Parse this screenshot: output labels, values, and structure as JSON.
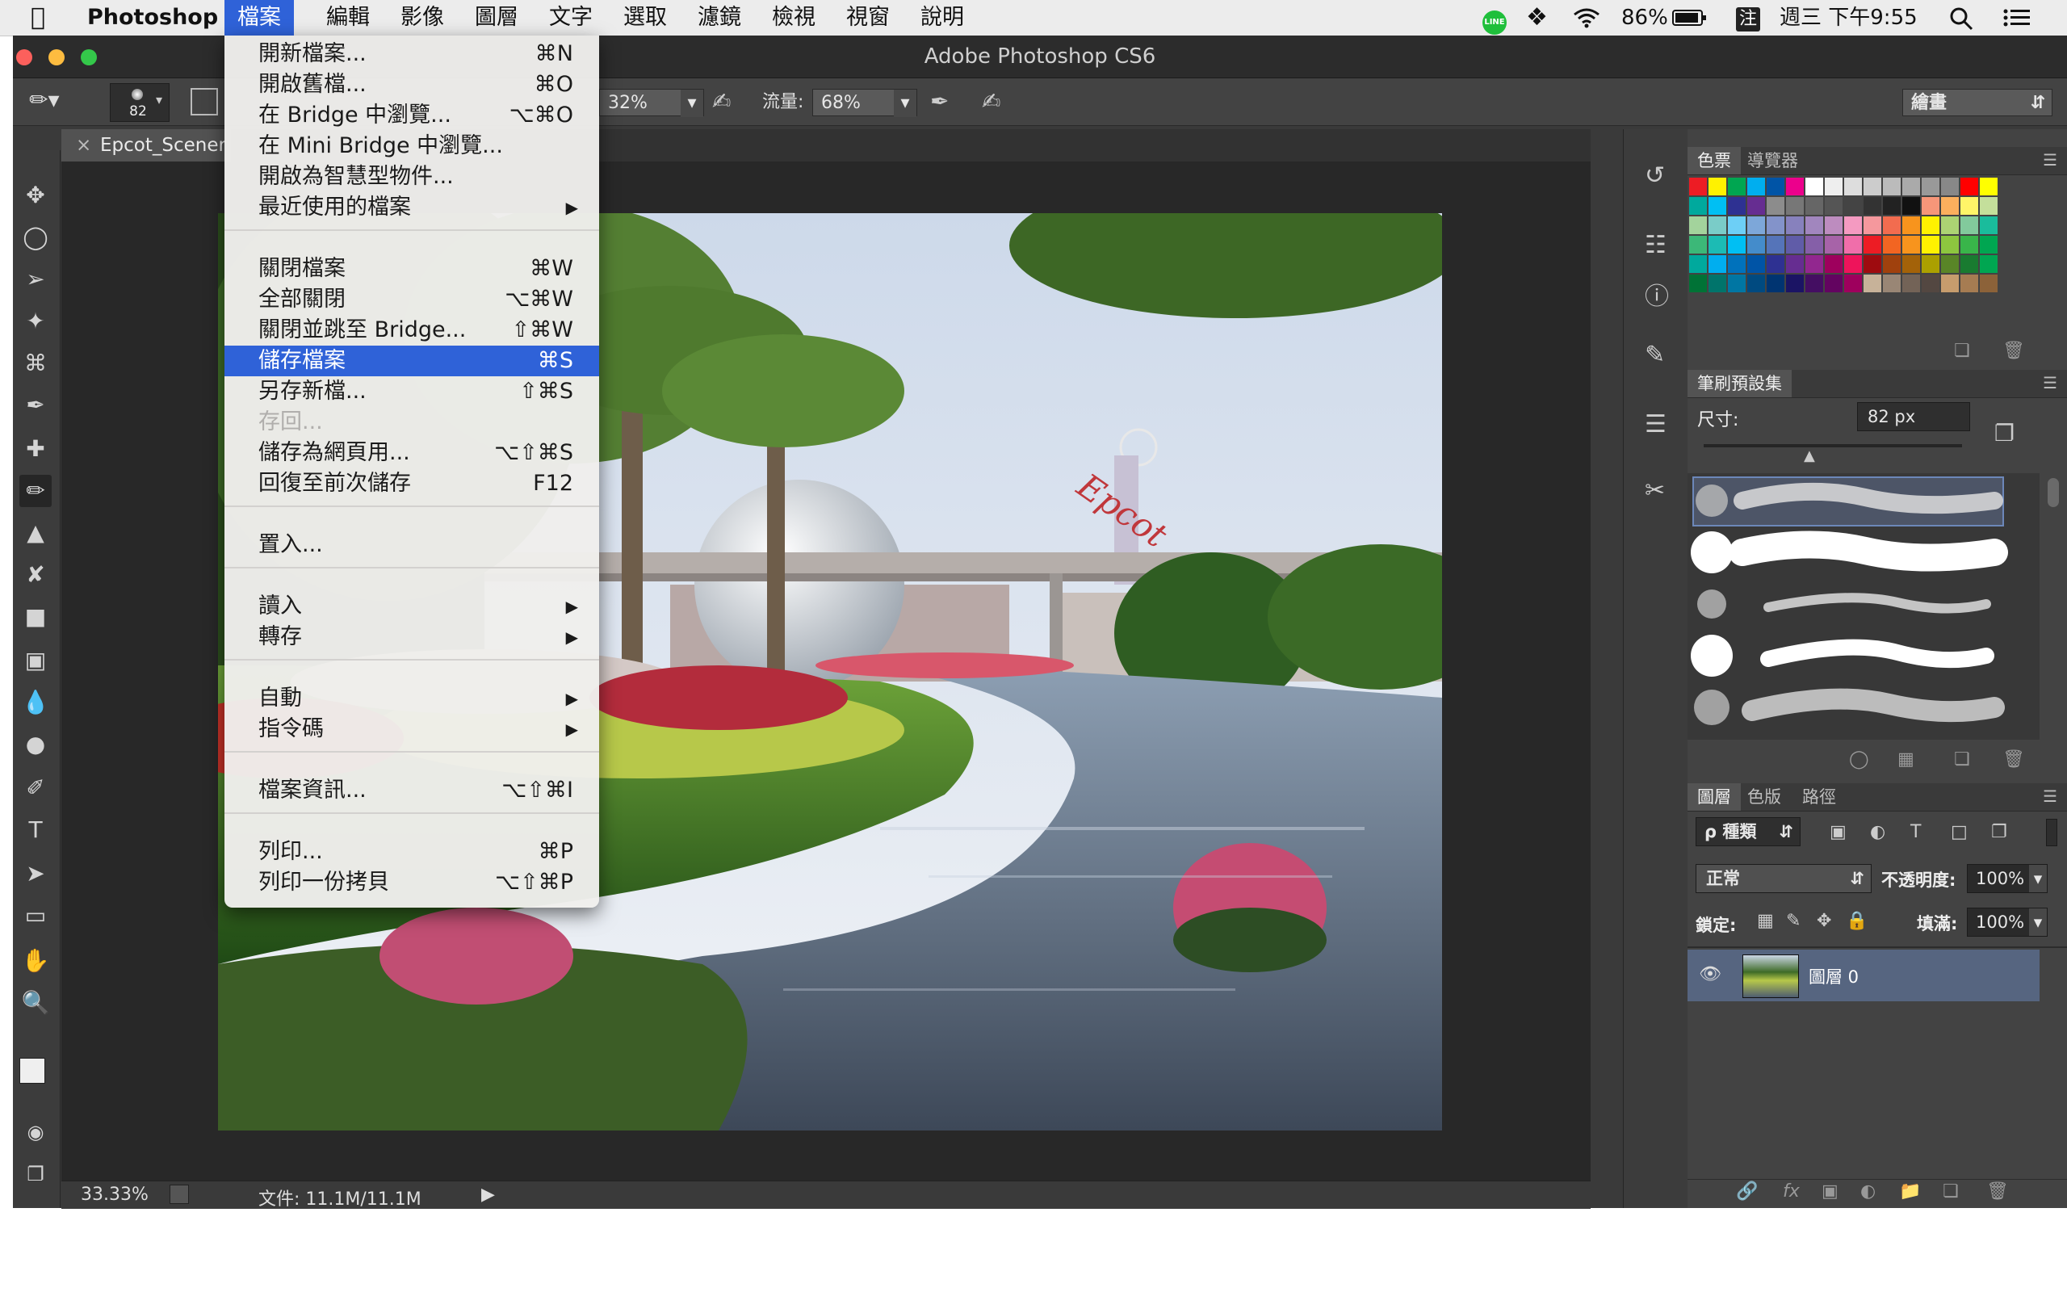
{
  "menubar": {
    "apple_icon": "apple-logo",
    "app_name": "Photoshop",
    "items": [
      "檔案",
      "編輯",
      "影像",
      "圖層",
      "文字",
      "選取",
      "濾鏡",
      "檢視",
      "視窗",
      "說明"
    ],
    "battery": "86%",
    "clock": "週三 下午9:55",
    "input_method": "注"
  },
  "window": {
    "title": "Adobe Photoshop CS6"
  },
  "options_bar": {
    "brush_size": "82",
    "opacity": "32%",
    "flow_label": "流量:",
    "flow": "68%",
    "workspace": "繪畫"
  },
  "document": {
    "tab_title": "Epcot_Scener",
    "close_glyph": "×",
    "zoom": "33.33%",
    "doc_info": "文件: 11.1M/11.1M",
    "photo_sign_text": "Epcot"
  },
  "file_menu": {
    "items": [
      {
        "label": "開新檔案...",
        "shortcut": "⌘N"
      },
      {
        "label": "開啟舊檔...",
        "shortcut": "⌘O"
      },
      {
        "label": "在 Bridge 中瀏覽...",
        "shortcut": "⌥⌘O"
      },
      {
        "label": "在 Mini Bridge 中瀏覽...",
        "shortcut": ""
      },
      {
        "label": "開啟為智慧型物件...",
        "shortcut": ""
      },
      {
        "label": "最近使用的檔案",
        "shortcut": "",
        "submenu": true
      },
      {
        "label": "關閉檔案",
        "shortcut": "⌘W"
      },
      {
        "label": "全部關閉",
        "shortcut": "⌥⌘W"
      },
      {
        "label": "關閉並跳至 Bridge...",
        "shortcut": "⇧⌘W"
      },
      {
        "label": "儲存檔案",
        "shortcut": "⌘S",
        "selected": true
      },
      {
        "label": "另存新檔...",
        "shortcut": "⇧⌘S"
      },
      {
        "label": "存回...",
        "shortcut": "",
        "disabled": true
      },
      {
        "label": "儲存為網頁用...",
        "shortcut": "⌥⇧⌘S"
      },
      {
        "label": "回復至前次儲存",
        "shortcut": "F12"
      },
      {
        "label": "置入...",
        "shortcut": ""
      },
      {
        "label": "讀入",
        "shortcut": "",
        "submenu": true
      },
      {
        "label": "轉存",
        "shortcut": "",
        "submenu": true
      },
      {
        "label": "自動",
        "shortcut": "",
        "submenu": true
      },
      {
        "label": "指令碼",
        "shortcut": "",
        "submenu": true
      },
      {
        "label": "檔案資訊...",
        "shortcut": "⌥⇧⌘I"
      },
      {
        "label": "列印...",
        "shortcut": "⌘P"
      },
      {
        "label": "列印一份拷貝",
        "shortcut": "⌥⇧⌘P"
      }
    ]
  },
  "swatches_panel": {
    "tabs": [
      "色票",
      "導覽器"
    ],
    "colors": [
      "#ed1c24",
      "#fff200",
      "#00a651",
      "#00aeef",
      "#0054a6",
      "#ec008c",
      "#ffffff",
      "#eeeeee",
      "#dddddd",
      "#cccccc",
      "#bbbbbb",
      "#aaaaaa",
      "#999999",
      "#888888",
      "#ff0000",
      "#ffff00",
      "#00a99d",
      "#00bff3",
      "#2e3192",
      "#662d91",
      "#8c8c8c",
      "#777777",
      "#666666",
      "#555555",
      "#444444",
      "#333333",
      "#222222",
      "#111111",
      "#f69679",
      "#fbaf5d",
      "#fff568",
      "#c4df9b",
      "#a3d39c",
      "#7accc8",
      "#6dcff6",
      "#7da7d9",
      "#8393ca",
      "#8781bd",
      "#a186be",
      "#bd8cbf",
      "#f49ac1",
      "#f5989d",
      "#f26c4f",
      "#f7941d",
      "#fff200",
      "#acd373",
      "#82ca9c",
      "#1abc9c",
      "#3cb878",
      "#1cbbb4",
      "#00bff3",
      "#448ccb",
      "#5574b9",
      "#605ca8",
      "#855fa8",
      "#a763a8",
      "#f06eaa",
      "#ed1c24",
      "#f26522",
      "#f7941d",
      "#fff200",
      "#8dc63f",
      "#39b54a",
      "#00a651",
      "#00a99d",
      "#00aeef",
      "#0072bc",
      "#0054a6",
      "#2e3192",
      "#662d91",
      "#92278f",
      "#9e005d",
      "#ee145b",
      "#9e0b0f",
      "#a0410d",
      "#a36209",
      "#aba000",
      "#598527",
      "#197b30",
      "#00a651",
      "#007236",
      "#00746b",
      "#0076a3",
      "#004a80",
      "#003471",
      "#1b1464",
      "#440e62",
      "#630460",
      "#9e005d",
      "#c7b299",
      "#998675",
      "#736357",
      "#534741",
      "#c69c6d",
      "#a67c52",
      "#8c6239"
    ]
  },
  "brush_presets_panel": {
    "tab": "筆刷預設集",
    "size_label": "尺寸:",
    "size_value": "82 px"
  },
  "layers_panel": {
    "tabs": [
      "圖層",
      "色版",
      "路徑"
    ],
    "filter_label": "ρ 種類",
    "blend_mode": "正常",
    "opacity_label": "不透明度:",
    "opacity_value": "100%",
    "lock_label": "鎖定:",
    "fill_label": "填滿:",
    "fill_value": "100%",
    "layer_name": "圖層 0",
    "bottom_icons": [
      "link-icon",
      "fx-icon",
      "mask-icon",
      "adjustment-icon",
      "folder-icon",
      "new-layer-icon",
      "trash-icon"
    ]
  }
}
